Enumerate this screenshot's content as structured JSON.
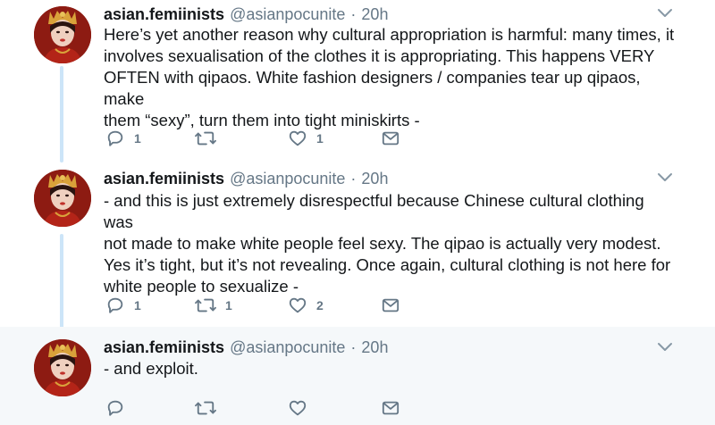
{
  "colors": {
    "thread_line": "#cce5f8",
    "highlight_bg": "#f5f8fa",
    "text": "#14171a",
    "secondary": "#657786"
  },
  "icons": [
    "reply-icon",
    "retweet-icon",
    "like-icon",
    "direct-message-icon",
    "chevron-down-icon"
  ],
  "tweets": [
    {
      "name": "asian.femiinists",
      "handle": "@asianpocunite",
      "separator": "·",
      "time": "20h",
      "lines": [
        "Here’s yet another reason why cultural appropriation is harmful: many times, it",
        "involves sexualisation of the clothes it is appropriating. This happens VERY",
        "OFTEN with qipaos. White fashion designers / companies tear up qipaos, make",
        "them “sexy”, turn them into tight miniskirts -"
      ],
      "replies": "1",
      "retweets": "",
      "likes": "1"
    },
    {
      "name": "asian.femiinists",
      "handle": "@asianpocunite",
      "separator": "·",
      "time": "20h",
      "lines": [
        "- and this is just extremely disrespectful because Chinese cultural clothing was",
        "not made to make white people feel sexy. The qipao is actually very modest.",
        "Yes it’s  tight, but it’s not revealing. Once again, cultural clothing is not here for",
        "white people to sexualize -"
      ],
      "replies": "1",
      "retweets": "1",
      "likes": "2"
    },
    {
      "name": "asian.femiinists",
      "handle": "@asianpocunite",
      "separator": "·",
      "time": "20h",
      "lines": [
        "- and exploit."
      ],
      "replies": "",
      "retweets": "",
      "likes": ""
    }
  ]
}
